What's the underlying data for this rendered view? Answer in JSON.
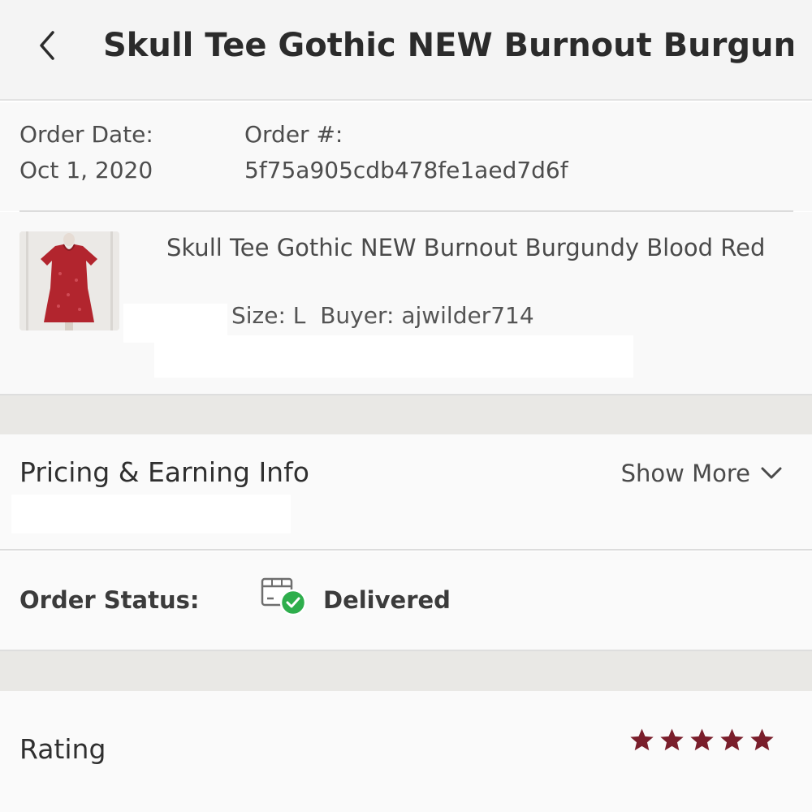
{
  "header": {
    "title": "Skull Tee Gothic NEW Burnout Burgund..."
  },
  "order": {
    "date_label": "Order Date:",
    "date_value": "Oct 1, 2020",
    "number_label": "Order #:",
    "number_value": "5f75a905cdb478fe1aed7d6f"
  },
  "item": {
    "title": "Skull Tee Gothic NEW Burnout Burgundy Blood Red",
    "meta": "Size: L  Buyer: ajwilder714",
    "thumbnail_color": "#b2252e"
  },
  "pricing": {
    "title": "Pricing & Earning Info",
    "show_more_label": "Show More"
  },
  "status": {
    "label": "Order Status:",
    "value": "Delivered",
    "icon": "delivered-box-icon",
    "check_color": "#2eae4c"
  },
  "rating": {
    "label": "Rating",
    "stars": 5,
    "max_stars": 5,
    "star_color": "#7a1e2b"
  }
}
